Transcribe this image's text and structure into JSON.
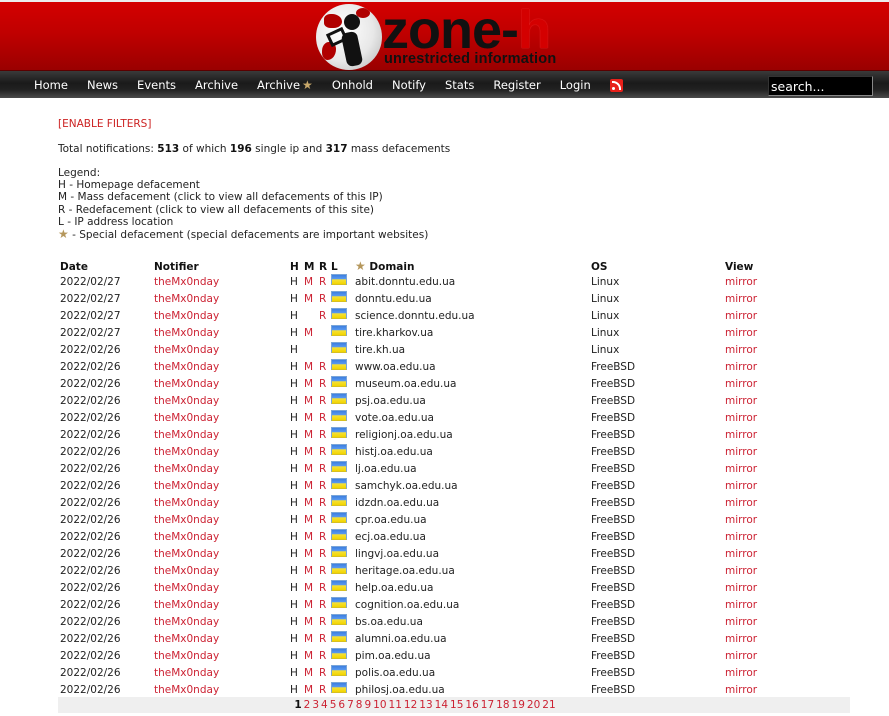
{
  "header": {
    "logo_word_main": "zone-",
    "logo_word_accent": "h",
    "logo_tagline": "unrestricted information"
  },
  "nav": {
    "items": [
      {
        "label": "Home"
      },
      {
        "label": "News"
      },
      {
        "label": "Events"
      },
      {
        "label": "Archive"
      },
      {
        "label": "Archive",
        "icon": "star-icon"
      },
      {
        "label": "Onhold"
      },
      {
        "label": "Notify"
      },
      {
        "label": "Stats"
      },
      {
        "label": "Register"
      },
      {
        "label": "Login"
      }
    ],
    "rss_icon": "rss-icon",
    "search_placeholder": "search..."
  },
  "filters_link": "[ENABLE FILTERS]",
  "summary": {
    "prefix": "Total notifications: ",
    "total": "513",
    "mid1": " of which ",
    "single": "196",
    "mid2": " single ip and ",
    "mass": "317",
    "suffix": " mass defacements"
  },
  "legend": {
    "title": "Legend:",
    "lines": [
      "H - Homepage defacement",
      "M - Mass defacement (click to view all defacements of this IP)",
      "R - Redefacement (click to view all defacements of this site)",
      "L - IP address location"
    ],
    "special": " - Special defacement (special defacements are important websites)"
  },
  "table": {
    "headers": {
      "date": "Date",
      "notifier": "Notifier",
      "h": "H",
      "m": "M",
      "r": "R",
      "l": "L",
      "domain": "Domain",
      "os": "OS",
      "view": "View"
    },
    "rows": [
      {
        "date": "2022/02/27",
        "notifier": "theMx0nday",
        "h": "H",
        "m": "M",
        "r": "R",
        "flag": "ua",
        "domain": "abit.donntu.edu.ua",
        "os": "Linux",
        "view": "mirror"
      },
      {
        "date": "2022/02/27",
        "notifier": "theMx0nday",
        "h": "H",
        "m": "M",
        "r": "R",
        "flag": "ua",
        "domain": "donntu.edu.ua",
        "os": "Linux",
        "view": "mirror"
      },
      {
        "date": "2022/02/27",
        "notifier": "theMx0nday",
        "h": "H",
        "m": "",
        "r": "R",
        "flag": "ua",
        "domain": "science.donntu.edu.ua",
        "os": "Linux",
        "view": "mirror"
      },
      {
        "date": "2022/02/27",
        "notifier": "theMx0nday",
        "h": "H",
        "m": "M",
        "r": "",
        "flag": "ua",
        "domain": "tire.kharkov.ua",
        "os": "Linux",
        "view": "mirror"
      },
      {
        "date": "2022/02/26",
        "notifier": "theMx0nday",
        "h": "H",
        "m": "",
        "r": "",
        "flag": "ua",
        "domain": "tire.kh.ua",
        "os": "Linux",
        "view": "mirror"
      },
      {
        "date": "2022/02/26",
        "notifier": "theMx0nday",
        "h": "H",
        "m": "M",
        "r": "R",
        "flag": "ua",
        "domain": "www.oa.edu.ua",
        "os": "FreeBSD",
        "view": "mirror"
      },
      {
        "date": "2022/02/26",
        "notifier": "theMx0nday",
        "h": "H",
        "m": "M",
        "r": "R",
        "flag": "ua",
        "domain": "museum.oa.edu.ua",
        "os": "FreeBSD",
        "view": "mirror"
      },
      {
        "date": "2022/02/26",
        "notifier": "theMx0nday",
        "h": "H",
        "m": "M",
        "r": "R",
        "flag": "ua",
        "domain": "psj.oa.edu.ua",
        "os": "FreeBSD",
        "view": "mirror"
      },
      {
        "date": "2022/02/26",
        "notifier": "theMx0nday",
        "h": "H",
        "m": "M",
        "r": "R",
        "flag": "ua",
        "domain": "vote.oa.edu.ua",
        "os": "FreeBSD",
        "view": "mirror"
      },
      {
        "date": "2022/02/26",
        "notifier": "theMx0nday",
        "h": "H",
        "m": "M",
        "r": "R",
        "flag": "ua",
        "domain": "religionj.oa.edu.ua",
        "os": "FreeBSD",
        "view": "mirror"
      },
      {
        "date": "2022/02/26",
        "notifier": "theMx0nday",
        "h": "H",
        "m": "M",
        "r": "R",
        "flag": "ua",
        "domain": "histj.oa.edu.ua",
        "os": "FreeBSD",
        "view": "mirror"
      },
      {
        "date": "2022/02/26",
        "notifier": "theMx0nday",
        "h": "H",
        "m": "M",
        "r": "R",
        "flag": "ua",
        "domain": "lj.oa.edu.ua",
        "os": "FreeBSD",
        "view": "mirror"
      },
      {
        "date": "2022/02/26",
        "notifier": "theMx0nday",
        "h": "H",
        "m": "M",
        "r": "R",
        "flag": "ua",
        "domain": "samchyk.oa.edu.ua",
        "os": "FreeBSD",
        "view": "mirror"
      },
      {
        "date": "2022/02/26",
        "notifier": "theMx0nday",
        "h": "H",
        "m": "M",
        "r": "R",
        "flag": "ua",
        "domain": "idzdn.oa.edu.ua",
        "os": "FreeBSD",
        "view": "mirror"
      },
      {
        "date": "2022/02/26",
        "notifier": "theMx0nday",
        "h": "H",
        "m": "M",
        "r": "R",
        "flag": "ua",
        "domain": "cpr.oa.edu.ua",
        "os": "FreeBSD",
        "view": "mirror"
      },
      {
        "date": "2022/02/26",
        "notifier": "theMx0nday",
        "h": "H",
        "m": "M",
        "r": "R",
        "flag": "ua",
        "domain": "ecj.oa.edu.ua",
        "os": "FreeBSD",
        "view": "mirror"
      },
      {
        "date": "2022/02/26",
        "notifier": "theMx0nday",
        "h": "H",
        "m": "M",
        "r": "R",
        "flag": "ua",
        "domain": "lingvj.oa.edu.ua",
        "os": "FreeBSD",
        "view": "mirror"
      },
      {
        "date": "2022/02/26",
        "notifier": "theMx0nday",
        "h": "H",
        "m": "M",
        "r": "R",
        "flag": "ua",
        "domain": "heritage.oa.edu.ua",
        "os": "FreeBSD",
        "view": "mirror"
      },
      {
        "date": "2022/02/26",
        "notifier": "theMx0nday",
        "h": "H",
        "m": "M",
        "r": "R",
        "flag": "ua",
        "domain": "help.oa.edu.ua",
        "os": "FreeBSD",
        "view": "mirror"
      },
      {
        "date": "2022/02/26",
        "notifier": "theMx0nday",
        "h": "H",
        "m": "M",
        "r": "R",
        "flag": "ua",
        "domain": "cognition.oa.edu.ua",
        "os": "FreeBSD",
        "view": "mirror"
      },
      {
        "date": "2022/02/26",
        "notifier": "theMx0nday",
        "h": "H",
        "m": "M",
        "r": "R",
        "flag": "ua",
        "domain": "bs.oa.edu.ua",
        "os": "FreeBSD",
        "view": "mirror"
      },
      {
        "date": "2022/02/26",
        "notifier": "theMx0nday",
        "h": "H",
        "m": "M",
        "r": "R",
        "flag": "ua",
        "domain": "alumni.oa.edu.ua",
        "os": "FreeBSD",
        "view": "mirror"
      },
      {
        "date": "2022/02/26",
        "notifier": "theMx0nday",
        "h": "H",
        "m": "M",
        "r": "R",
        "flag": "ua",
        "domain": "pim.oa.edu.ua",
        "os": "FreeBSD",
        "view": "mirror"
      },
      {
        "date": "2022/02/26",
        "notifier": "theMx0nday",
        "h": "H",
        "m": "M",
        "r": "R",
        "flag": "ua",
        "domain": "polis.oa.edu.ua",
        "os": "FreeBSD",
        "view": "mirror"
      },
      {
        "date": "2022/02/26",
        "notifier": "theMx0nday",
        "h": "H",
        "m": "M",
        "r": "R",
        "flag": "ua",
        "domain": "philosj.oa.edu.ua",
        "os": "FreeBSD",
        "view": "mirror"
      }
    ]
  },
  "pagination": {
    "current": "1",
    "pages": [
      "2",
      "3",
      "4",
      "5",
      "6",
      "7",
      "8",
      "9",
      "10",
      "11",
      "12",
      "13",
      "14",
      "15",
      "16",
      "17",
      "18",
      "19",
      "20",
      "21"
    ]
  },
  "colors": {
    "brand_red": "#c00000",
    "link_red": "#cc2233",
    "nav_bg": "#1a1a1a"
  }
}
